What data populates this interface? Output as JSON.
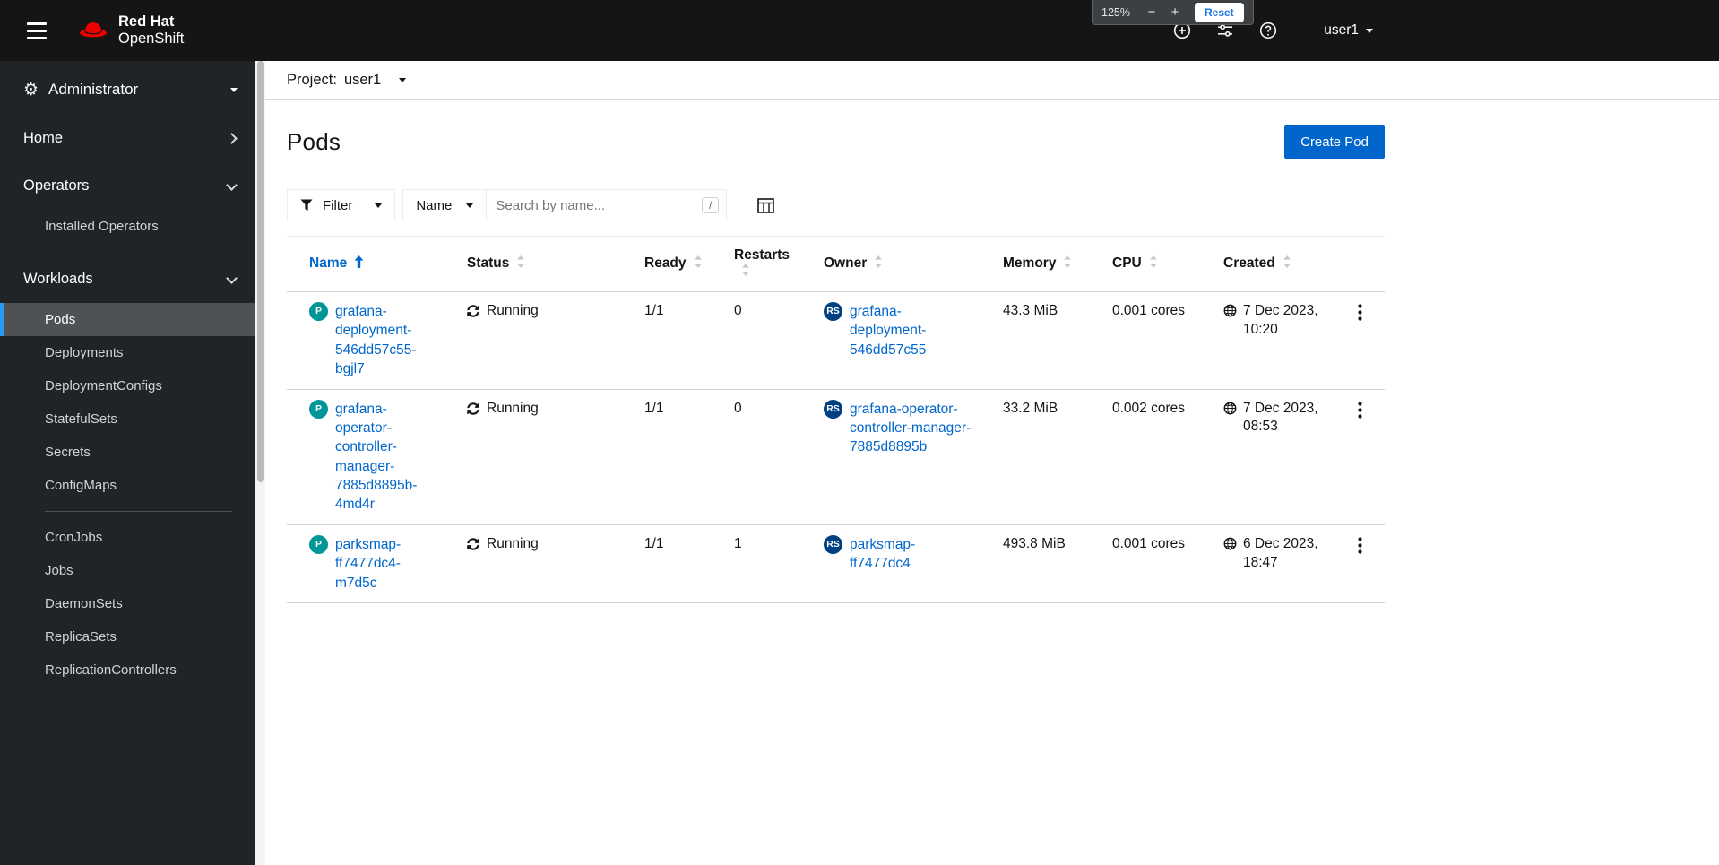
{
  "masthead": {
    "brand_line1": "Red Hat",
    "brand_line2": "OpenShift",
    "user_label": "user1"
  },
  "browser_zoom_popup": {
    "level": "125%",
    "minus_label": "−",
    "plus_label": "+",
    "reset_label": "Reset"
  },
  "sidebar": {
    "perspective_label": "Administrator",
    "sections": [
      {
        "label": "Home",
        "expanded": false,
        "items": []
      },
      {
        "label": "Operators",
        "expanded": true,
        "items": [
          {
            "label": "Installed Operators"
          }
        ]
      },
      {
        "label": "Workloads",
        "expanded": true,
        "items": [
          {
            "label": "Pods",
            "active": true
          },
          {
            "label": "Deployments"
          },
          {
            "label": "DeploymentConfigs"
          },
          {
            "label": "StatefulSets"
          },
          {
            "label": "Secrets"
          },
          {
            "label": "ConfigMaps"
          },
          {
            "divider": true
          },
          {
            "label": "CronJobs"
          },
          {
            "label": "Jobs"
          },
          {
            "label": "DaemonSets"
          },
          {
            "label": "ReplicaSets"
          },
          {
            "label": "ReplicationControllers"
          }
        ]
      }
    ]
  },
  "project_bar": {
    "label": "Project:",
    "value": "user1"
  },
  "page": {
    "title": "Pods",
    "create_button_label": "Create Pod"
  },
  "toolbar": {
    "filter_label": "Filter",
    "attribute_label": "Name",
    "search_placeholder": "Search by name...",
    "search_shortcut": "/"
  },
  "table": {
    "columns": [
      {
        "label": "Name",
        "sorted": "asc"
      },
      {
        "label": "Status"
      },
      {
        "label": "Ready"
      },
      {
        "label": "Restarts"
      },
      {
        "label": "Owner"
      },
      {
        "label": "Memory"
      },
      {
        "label": "CPU"
      },
      {
        "label": "Created"
      }
    ],
    "rows": [
      {
        "badge": "P",
        "name": "grafana-deployment-546dd57c55-bgjl7",
        "status": "Running",
        "ready": "1/1",
        "restarts": "0",
        "owner_badge": "RS",
        "owner": "grafana-deployment-546dd57c55",
        "memory": "43.3 MiB",
        "cpu": "0.001 cores",
        "created": "7 Dec 2023, 10:20"
      },
      {
        "badge": "P",
        "name": "grafana-operator-controller-manager-7885d8895b-4md4r",
        "status": "Running",
        "ready": "1/1",
        "restarts": "0",
        "owner_badge": "RS",
        "owner": "grafana-operator-controller-manager-7885d8895b",
        "memory": "33.2 MiB",
        "cpu": "0.002 cores",
        "created": "7 Dec 2023, 08:53"
      },
      {
        "badge": "P",
        "name": "parksmap-ff7477dc4-m7d5c",
        "status": "Running",
        "ready": "1/1",
        "restarts": "1",
        "owner_badge": "RS",
        "owner": "parksmap-ff7477dc4",
        "memory": "493.8 MiB",
        "cpu": "0.001 cores",
        "created": "6 Dec 2023, 18:47"
      }
    ]
  },
  "colors": {
    "link": "#0066cc",
    "primary": "#0066cc",
    "pod_badge": "#009596",
    "rs_badge": "#004080",
    "nav_active_bg": "#4f5255",
    "nav_active_border": "#2b9af3",
    "masthead_bg": "#151515",
    "sidebar_bg": "#212427"
  }
}
